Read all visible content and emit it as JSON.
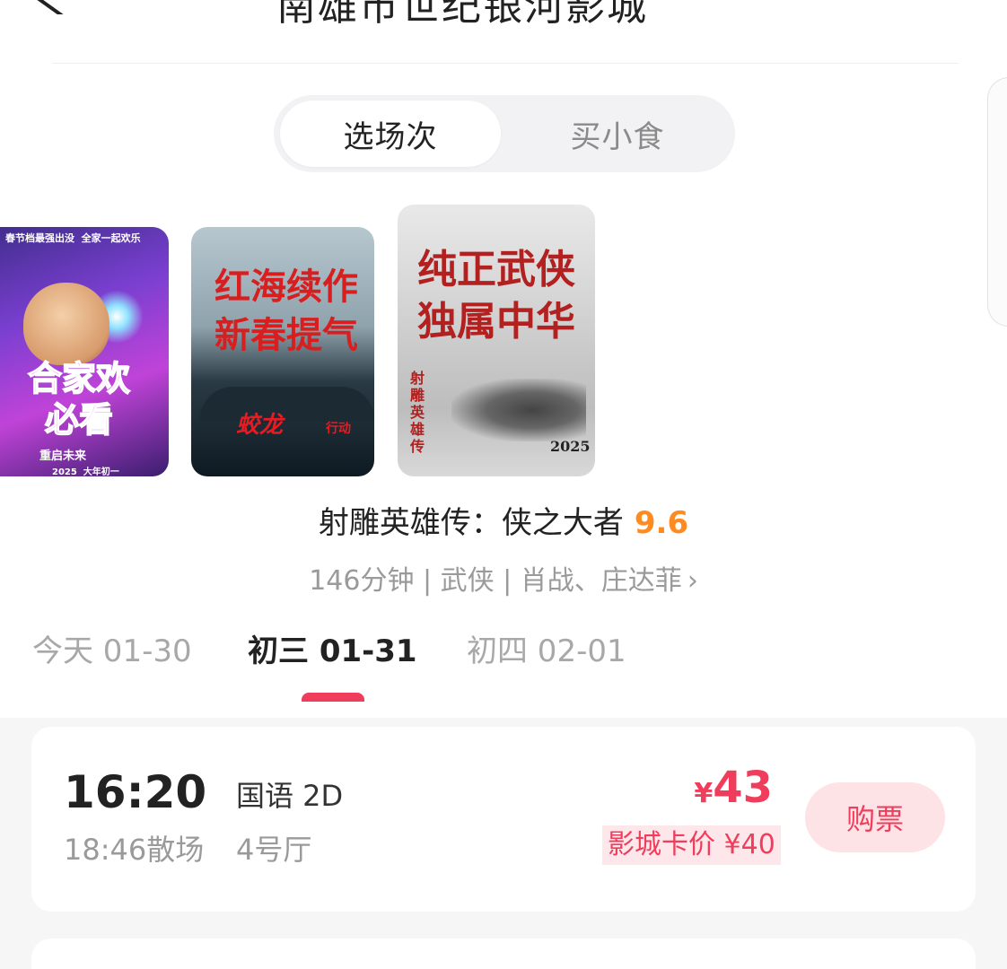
{
  "header": {
    "title": "南雄市世纪银河影城",
    "back_icon": "chevron-left-icon"
  },
  "segmented": {
    "tabs": [
      "选场次",
      "买小食"
    ],
    "active_index": 0
  },
  "posters": [
    {
      "top_text": "春节档最强出没  全家一起欢乐",
      "main_text": "合家欢\n必看",
      "sub_text": "重启未来",
      "year_text": "2025  大年初一"
    },
    {
      "main_text": "红海续作\n新春提气",
      "sub_text": "蛟龙",
      "sub_text2": "行动"
    },
    {
      "main_text": "纯正武侠\n独属中华",
      "side_text": "射\n雕\n英\n雄\n传",
      "year_text": "2025"
    }
  ],
  "movie": {
    "title": "射雕英雄传：侠之大者",
    "score": "9.6",
    "meta": "146分钟 | 武侠 | 肖战、庄达菲",
    "meta_arrow": "›"
  },
  "dates": [
    {
      "label": "今天 01-30"
    },
    {
      "label": "初三 01-31"
    },
    {
      "label": "初四 02-01"
    }
  ],
  "active_date_index": 1,
  "showtimes": [
    {
      "start": "16:20",
      "end": "18:46散场",
      "lang": "国语 2D",
      "hall": "4号厅",
      "currency": "¥",
      "price": "43",
      "member_price": "影城卡价 ¥40",
      "buy_label": "购票"
    }
  ],
  "colors": {
    "accent": "#f03d5c",
    "score": "#ff8a1f",
    "muted": "#9a9a9a",
    "buy_bg": "#fde3e6"
  }
}
